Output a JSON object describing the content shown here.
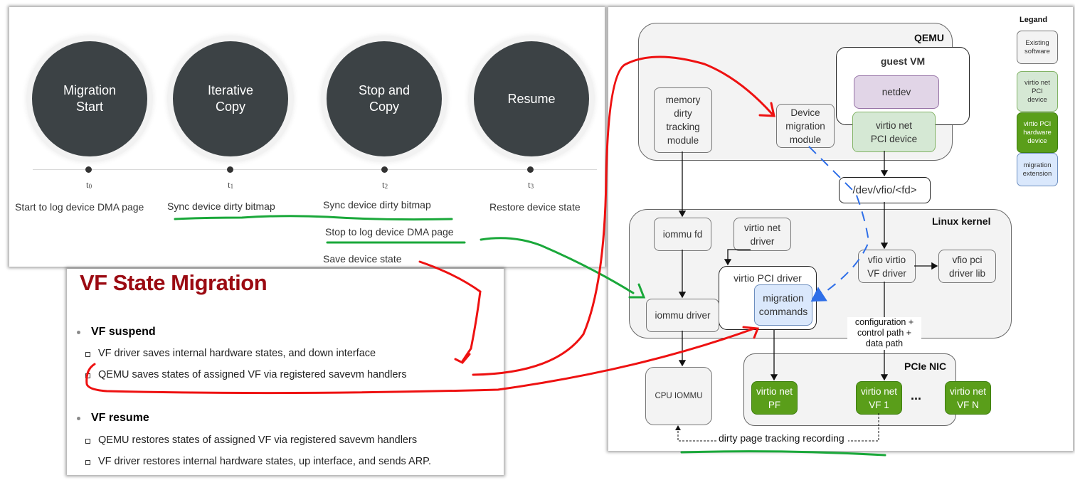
{
  "timeline": {
    "phases": [
      {
        "label": "Migration\nStart",
        "tick": "t",
        "tick_sub": "0",
        "notes": [
          "Start to log device DMA page"
        ]
      },
      {
        "label": "Iterative\nCopy",
        "tick": "t",
        "tick_sub": "1",
        "notes": [
          "Sync device dirty bitmap"
        ]
      },
      {
        "label": "Stop and\nCopy",
        "tick": "t",
        "tick_sub": "2",
        "notes": [
          "Sync device dirty bitmap",
          "Stop to log device DMA page",
          "Save device state"
        ]
      },
      {
        "label": "Resume",
        "tick": "t",
        "tick_sub": "3",
        "notes": [
          "Restore device state"
        ]
      }
    ]
  },
  "slide": {
    "title": "VF State Migration",
    "sections": [
      {
        "heading": "VF suspend",
        "items": [
          "VF driver saves internal hardware states, and down interface",
          "QEMU saves states of assigned VF via registered savevm handlers"
        ]
      },
      {
        "heading": "VF resume",
        "items": [
          "QEMU restores states of assigned VF via registered savevm handlers",
          "VF driver restores internal hardware states, up interface, and sends ARP."
        ]
      }
    ]
  },
  "architecture": {
    "regions": {
      "qemu": "QEMU",
      "guest_vm": "guest VM",
      "linux_kernel": "Linux kernel",
      "pcie_nic": "PCIe NIC"
    },
    "boxes": {
      "memory_dirty_tracking": "memory\ndirty\ntracking\nmodule",
      "device_migration": "Device\nmigration\nmodule",
      "netdev": "netdev",
      "virtio_net_pci_device": "virtio net\nPCI device",
      "dev_vfio": "/dev/vfio/<fd>",
      "iommu_fd": "iommu fd",
      "virtio_net_driver": "virtio net\ndriver",
      "virtio_pci_driver": "virtio PCI driver",
      "migration_commands": "migration\ncommands",
      "vfio_virtio_vf_driver": "vfio virtio\nVF driver",
      "vfio_pci_driver_lib": "vfio pci\ndriver lib",
      "iommu_driver": "iommu driver",
      "cpu_iommu": "CPU IOMMU",
      "virtio_net_pf": "virtio net\nPF",
      "virtio_net_vf1": "virtio net\nVF 1",
      "virtio_net_vfn": "virtio net\nVF N",
      "ellipsis": "..."
    },
    "path_labels": {
      "config_path": "configuration +\ncontrol path +\ndata path",
      "dirty_page": "dirty page tracking recording"
    },
    "legend": {
      "title": "Legand",
      "items": [
        {
          "label": "Existing\nsoftware",
          "color": "#f3f3f3"
        },
        {
          "label": "virtio net\nPCI\ndevice",
          "color": "#d5e8d4"
        },
        {
          "label": "virtio PCI\nhardware\ndevice",
          "color": "#5a9e1a"
        },
        {
          "label": "migration\nextension",
          "color": "#dae8fc"
        }
      ]
    }
  },
  "annotations": {
    "red": "#ee1111",
    "green": "#1aa83a",
    "blue_dashed": "#2f6fe8"
  }
}
